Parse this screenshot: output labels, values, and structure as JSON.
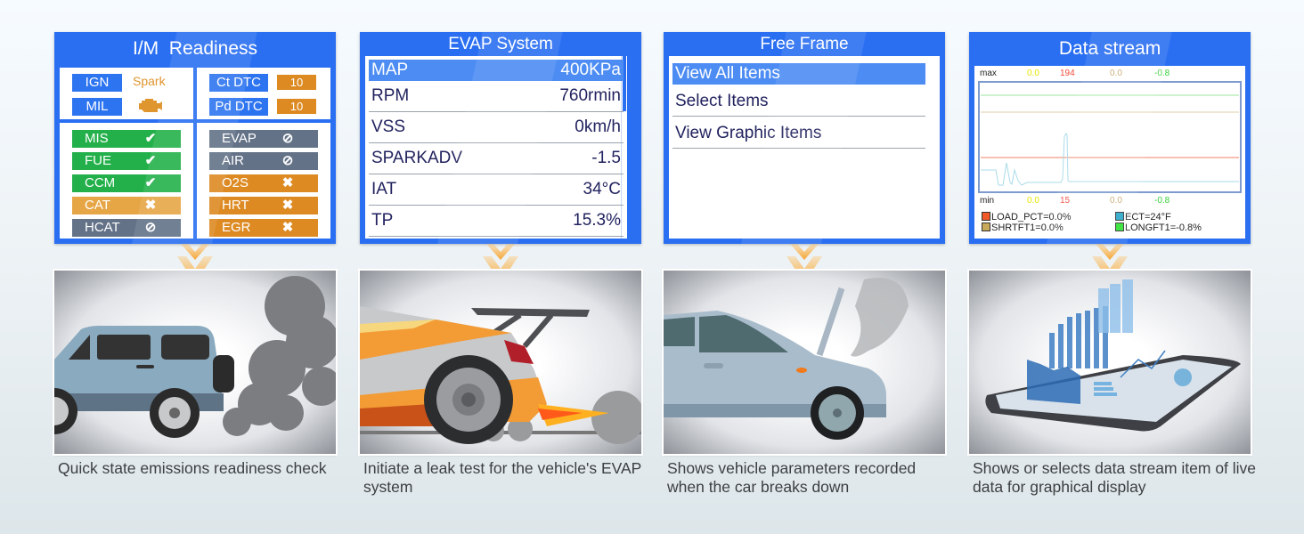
{
  "panels": [
    {
      "title": "I/M  Readiness",
      "top_left": {
        "ign_label": "IGN",
        "mil_label": "MIL",
        "spark_label": "Spark",
        "icon": "engine-icon"
      },
      "top_right": {
        "ct_label": "Ct DTC",
        "ct_value": "10",
        "pd_label": "Pd DTC",
        "pd_value": "10"
      },
      "left_statuses": [
        {
          "label": "MIS",
          "state": "complete",
          "icon": "✔",
          "color": "#23b04a"
        },
        {
          "label": "FUE",
          "state": "complete",
          "icon": "✔",
          "color": "#23b04a"
        },
        {
          "label": "CCM",
          "state": "complete",
          "icon": "✔",
          "color": "#23b04a"
        },
        {
          "label": "CAT",
          "state": "incomplete",
          "icon": "✖",
          "color": "#e7a646"
        },
        {
          "label": "HCAT",
          "state": "not-supported",
          "icon": "⊘",
          "color": "#637287"
        }
      ],
      "right_statuses": [
        {
          "label": "EVAP",
          "state": "not-supported",
          "icon": "⊘",
          "color": "#637287"
        },
        {
          "label": "AIR",
          "state": "not-supported",
          "icon": "⊘",
          "color": "#637287"
        },
        {
          "label": "O2S",
          "state": "incomplete",
          "icon": "✖",
          "color": "#dd8a23"
        },
        {
          "label": "HRT",
          "state": "incomplete",
          "icon": "✖",
          "color": "#dd8a23"
        },
        {
          "label": "EGR",
          "state": "incomplete",
          "icon": "✖",
          "color": "#dd8a23"
        }
      ],
      "illustration": "suv-exhaust-smoke",
      "caption": "Quick state emissions readiness check"
    },
    {
      "title": "EVAP System",
      "rows": [
        {
          "key": "MAP",
          "value": "400KPa",
          "selected": true
        },
        {
          "key": "RPM",
          "value": "760rmin"
        },
        {
          "key": "VSS",
          "value": "0km/h"
        },
        {
          "key": "SPARKADV",
          "value": "-1.5"
        },
        {
          "key": "IAT",
          "value": "34°C"
        },
        {
          "key": "TP",
          "value": "15.3%"
        }
      ],
      "illustration": "race-car-exhaust-flame",
      "caption": "Initiate a leak test for the vehicle's EVAP system"
    },
    {
      "title": "Free Frame",
      "items": [
        {
          "label": "View All Items",
          "selected": true
        },
        {
          "label": "Select Items"
        },
        {
          "label": "View Graphic Items"
        }
      ],
      "illustration": "car-broken-down-hood-smoke",
      "caption": "Shows vehicle parameters recorded when the car breaks down"
    },
    {
      "title": "Data stream",
      "max_label": "max",
      "min_label": "min",
      "max_values": [
        {
          "value": "0.0",
          "color": "#e6e600"
        },
        {
          "value": "194",
          "color": "#f04a3a"
        },
        {
          "value": "0.0",
          "color": "#c8a870"
        },
        {
          "value": "-0.8",
          "color": "#3ccf3c"
        }
      ],
      "min_values": [
        {
          "value": "0.0",
          "color": "#e6e600"
        },
        {
          "value": "15",
          "color": "#f04a3a"
        },
        {
          "value": "0.0",
          "color": "#c8a870"
        },
        {
          "value": "-0.8",
          "color": "#3ccf3c"
        }
      ],
      "legend": [
        {
          "label": "LOAD_PCT=0.0%",
          "color": "#f05a28"
        },
        {
          "label": "ECT=24°F",
          "color": "#2aa6c8"
        },
        {
          "label": "SHRTFT1=0.0%",
          "color": "#c8a85a"
        },
        {
          "label": "LONGFT1=-0.8%",
          "color": "#2ee02e"
        }
      ],
      "illustration": "tablet-holographic-charts",
      "caption": "Shows or selects data stream item of live data for graphical display"
    }
  ]
}
